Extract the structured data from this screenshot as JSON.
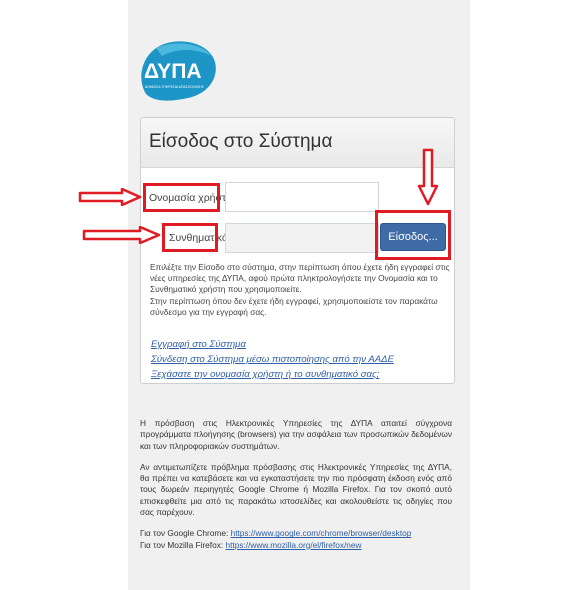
{
  "logo": {
    "text": "ΔΥΠΑ",
    "subtitle": "ΔΗΜΟΣΙΑ ΥΠΗΡΕΣΙΑ ΑΠΑΣΧΟΛΗΣΗΣ"
  },
  "login": {
    "title": "Είσοδος στο Σύστημα",
    "username_label": "Ονομασία χρήστη",
    "password_label": "Συνθηματικό",
    "username_value": "",
    "password_value": "",
    "submit_label": "Είσοδος..."
  },
  "info": {
    "paragraph1": "Επιλέξτε την Είσοδο στο σύστημα, στην περίπτωση όπου έχετε ήδη εγγραφεί στις νέες υπηρεσίες της ΔΥΠΑ, αφού πρώτα πληκτρολογήσετε την Ονομασία και το Συνθηματικό χρήστη που χρησιμοποιείτε.",
    "paragraph2": "Στην περίπτωση όπου δεν έχετε ήδη εγγραφεί, χρησιμοποιείστε τον παρακάτω σύνδεσμο για την εγγραφή σας."
  },
  "links": {
    "register": "Εγγραφή στο Σύστημα",
    "aade": "Σύνδεση στο Σύστημα μέσω πιστοποίησης από την ΑΑΔΕ",
    "forgot": "Ξεχάσατε την ονομασία χρήστη ή το συνθηματικό σας;"
  },
  "notice": {
    "paragraph1": "Η πρόσβαση στις Ηλεκτρονικές Υπηρεσίες της ΔΥΠΑ απαιτεί σύγχρονα προγράμματα πλοήγησης (browsers) για την ασφάλεια των προσωπικών δεδομένων και των πληροφοριακών συστημάτων.",
    "paragraph2": "Αν αντιμετωπίζετε πρόβλημα πρόσβασης στις Ηλεκτρονικές Υπηρεσίες της ΔΥΠΑ, θα πρέπει να κατεβάσετε και να εγκαταστήσετε την πιο πρόσφατη έκδοση ενός από τους δωρεάν περιηγητές Google Chrome ή Mozilla Firefox. Για τον σκοπό αυτό επισκεφθείτε μια από τις παρακάτω ιστοσελίδες και ακολουθείστε τις οδηγίες που σας παρέχουν.",
    "chrome_prefix": "Για τον Google Chrome:",
    "chrome_url": "https://www.google.com/chrome/browser/desktop",
    "firefox_prefix": "Για τον Mozilla Firefox:",
    "firefox_url": "https://www.mozilla.org/el/firefox/new"
  },
  "colors": {
    "accent": "#3e6aa6",
    "annotation": "#e01b24",
    "link": "#2f5fa6",
    "logo": "#1d95c7"
  }
}
